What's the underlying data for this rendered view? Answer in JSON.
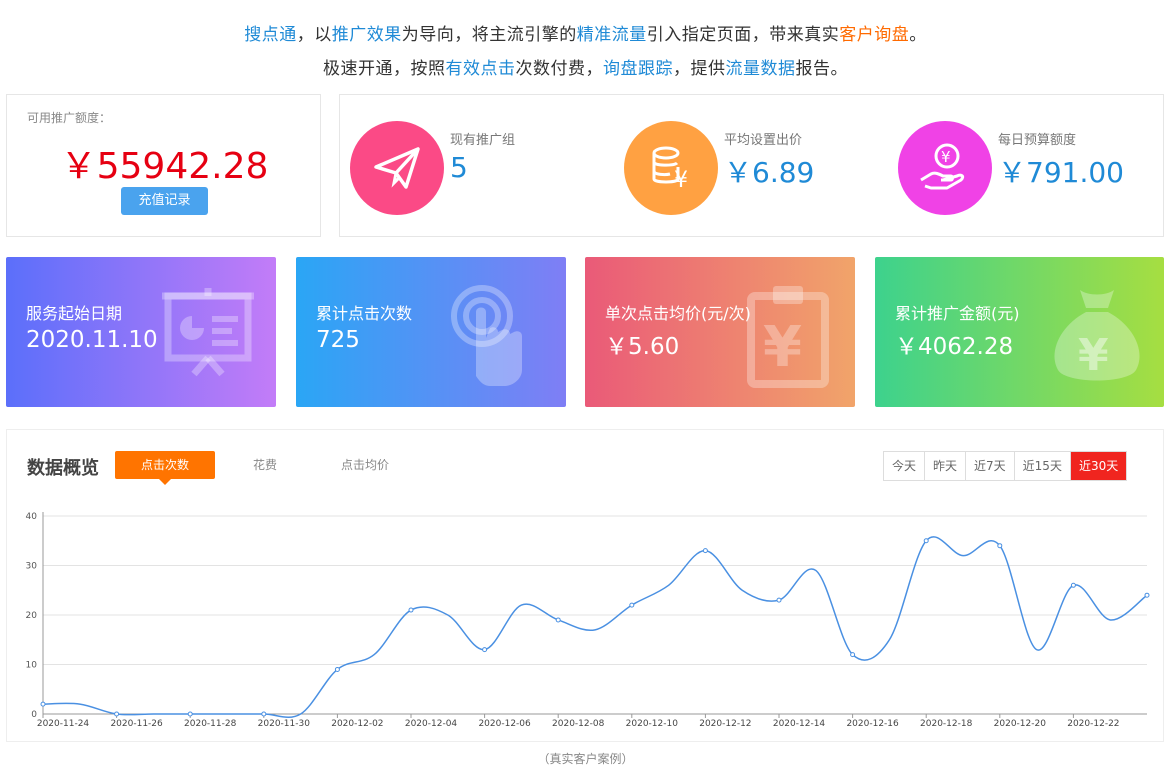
{
  "headline": {
    "line1": [
      {
        "text": "搜点通",
        "style": "blue"
      },
      {
        "text": "，以",
        "style": "plain"
      },
      {
        "text": "推广效果",
        "style": "blue"
      },
      {
        "text": "为导向，将主流引擎的",
        "style": "plain"
      },
      {
        "text": "精准流量",
        "style": "blue"
      },
      {
        "text": "引入指定页面，带来真实",
        "style": "plain"
      },
      {
        "text": "客户询盘",
        "style": "orange"
      },
      {
        "text": "。",
        "style": "plain"
      }
    ],
    "line2": [
      {
        "text": "极速开通，按照",
        "style": "plain"
      },
      {
        "text": "有效点击",
        "style": "blue"
      },
      {
        "text": "次数付费，",
        "style": "plain"
      },
      {
        "text": "询盘跟踪",
        "style": "blue"
      },
      {
        "text": "，提供",
        "style": "plain"
      },
      {
        "text": "流量数据",
        "style": "blue"
      },
      {
        "text": "报告。",
        "style": "plain"
      }
    ]
  },
  "balance": {
    "label": "可用推广额度：",
    "value": "￥55942.28",
    "button": "充值记录"
  },
  "stats": [
    {
      "label": "现有推广组",
      "value": "5",
      "icon": "paper-plane-icon",
      "color": "#fb4a86"
    },
    {
      "label": "平均设置出价",
      "value": "￥6.89",
      "icon": "coin-stack-icon",
      "color": "#ffa142"
    },
    {
      "label": "每日预算额度",
      "value": "￥791.00",
      "icon": "hand-coin-icon",
      "color": "#f042e6"
    }
  ],
  "cards": [
    {
      "title": "服务起始日期",
      "value": "2020.11.10",
      "icon": "presentation-board-icon",
      "from": "#5b6ffa",
      "to": "#c37cf8"
    },
    {
      "title": "累计点击次数",
      "value": "725",
      "icon": "touch-click-icon",
      "from": "#2aa6f5",
      "to": "#7f7ef5"
    },
    {
      "title": "单次点击均价(元/次)",
      "value": "￥5.60",
      "icon": "clipboard-yuan-icon",
      "from": "#ea5a78",
      "to": "#f1a46a"
    },
    {
      "title": "累计推广金额(元)",
      "value": "￥4062.28",
      "icon": "money-bag-icon",
      "from": "#3dd28d",
      "to": "#a6de41"
    }
  ],
  "chart_panel": {
    "title": "数据概览",
    "tabs": [
      "点击次数",
      "花费",
      "点击均价"
    ],
    "active_tab": 0,
    "ranges": [
      "今天",
      "昨天",
      "近7天",
      "近15天",
      "近30天"
    ],
    "active_range": 4
  },
  "chart_data": {
    "type": "line",
    "x": [
      "2020-11-24",
      "2020-11-25",
      "2020-11-26",
      "2020-11-27",
      "2020-11-28",
      "2020-11-29",
      "2020-11-30",
      "2020-12-01",
      "2020-12-02",
      "2020-12-03",
      "2020-12-04",
      "2020-12-05",
      "2020-12-06",
      "2020-12-07",
      "2020-12-08",
      "2020-12-09",
      "2020-12-10",
      "2020-12-11",
      "2020-12-12",
      "2020-12-13",
      "2020-12-14",
      "2020-12-15",
      "2020-12-16",
      "2020-12-17",
      "2020-12-18",
      "2020-12-19",
      "2020-12-20",
      "2020-12-21",
      "2020-12-22",
      "2020-12-23"
    ],
    "series": [
      {
        "values": [
          2,
          2,
          0,
          0,
          0,
          0,
          0,
          0,
          9,
          12,
          21,
          20,
          13,
          22,
          19,
          17,
          22,
          26,
          33,
          25,
          23,
          29,
          12,
          15,
          35,
          32,
          34,
          13,
          26,
          19,
          24
        ],
        "color": "#4a90e2"
      }
    ],
    "x_tick_labels": [
      "2020-11-24",
      "2020-11-26",
      "2020-11-28",
      "2020-11-30",
      "2020-12-02",
      "2020-12-04",
      "2020-12-06",
      "2020-12-08",
      "2020-12-10",
      "2020-12-12",
      "2020-12-14",
      "2020-12-16",
      "2020-12-18",
      "2020-12-20",
      "2020-12-22"
    ],
    "y_ticks": [
      0,
      10,
      20,
      30,
      40
    ],
    "ylim": [
      0,
      40
    ],
    "grid": true
  },
  "footnote": "（真实客户案例）"
}
